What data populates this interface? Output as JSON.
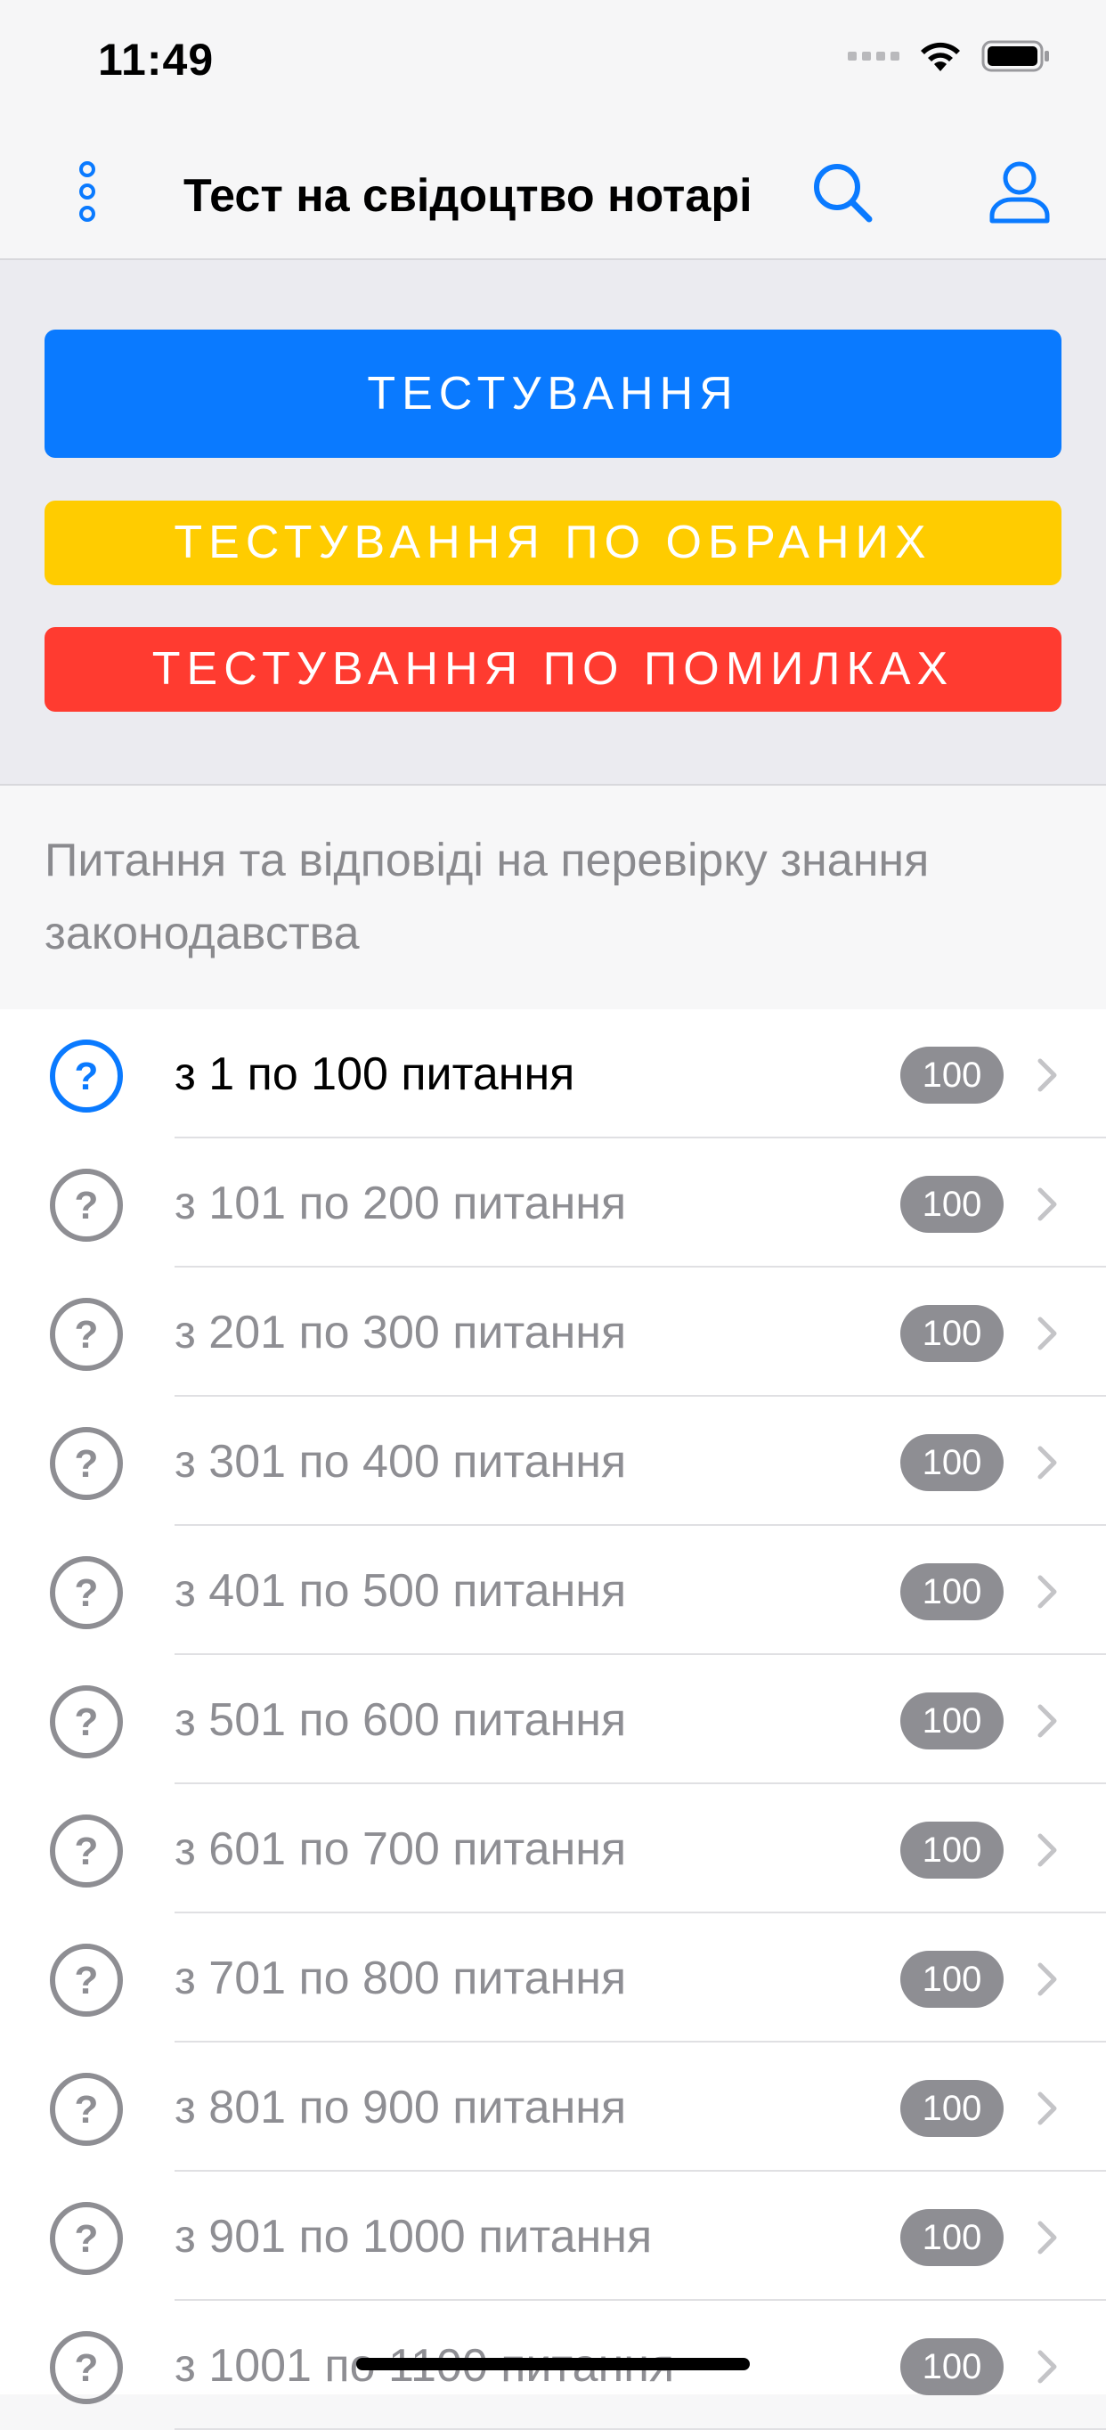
{
  "status_bar": {
    "time": "11:49"
  },
  "nav": {
    "title": "Тест на свідоцтво нотаріуса",
    "more_icon": "more-vertical-icon",
    "search_icon": "search-icon",
    "user_icon": "user-icon"
  },
  "buttons": {
    "testing": "ТЕСТУВАННЯ",
    "favorites": "ТЕСТУВАННЯ ПО ОБРАНИХ",
    "errors": "ТЕСТУВАННЯ ПО ПОМИЛКАХ"
  },
  "colors": {
    "accent": "#0a7aff",
    "yellow": "#ffcc00",
    "red": "#ff3b30",
    "badge": "#8e8e93"
  },
  "section": {
    "header": "Питання та відповіді на перевірку знання законодавства"
  },
  "list": {
    "items": [
      {
        "label": "з 1 по 100 питання",
        "count": "100"
      },
      {
        "label": "з 101 по 200 питання",
        "count": "100"
      },
      {
        "label": "з 201 по 300 питання",
        "count": "100"
      },
      {
        "label": "з 301 по 400 питання",
        "count": "100"
      },
      {
        "label": "з 401 по 500 питання",
        "count": "100"
      },
      {
        "label": "з 501 по 600 питання",
        "count": "100"
      },
      {
        "label": "з 601 по 700 питання",
        "count": "100"
      },
      {
        "label": "з 701 по 800 питання",
        "count": "100"
      },
      {
        "label": "з 801 по 900 питання",
        "count": "100"
      },
      {
        "label": "з 901 по 1000 питання",
        "count": "100"
      },
      {
        "label": "з 1001 по 1100 питання",
        "count": "100"
      }
    ]
  }
}
